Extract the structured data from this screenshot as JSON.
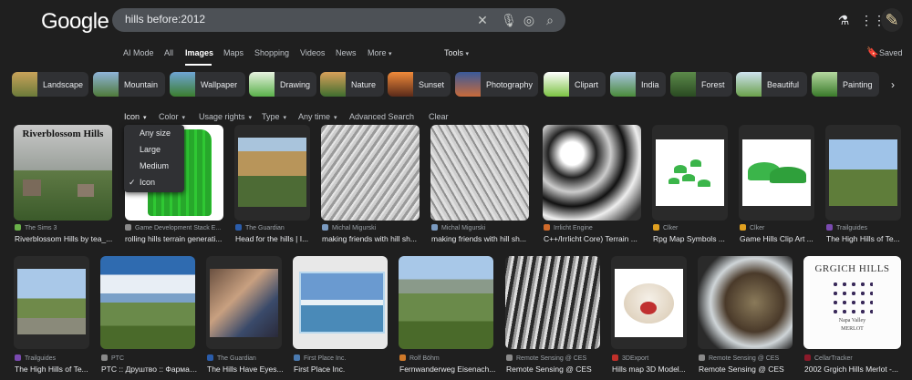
{
  "brand": {
    "logo": "Google"
  },
  "search": {
    "query": "hills before:2012"
  },
  "header": {
    "saved_label": "Saved"
  },
  "tabs": [
    {
      "label": "AI Mode"
    },
    {
      "label": "All"
    },
    {
      "label": "Images",
      "active": true
    },
    {
      "label": "Maps"
    },
    {
      "label": "Shopping"
    },
    {
      "label": "Videos"
    },
    {
      "label": "News"
    },
    {
      "label": "More"
    },
    {
      "label": "Tools"
    }
  ],
  "chips": [
    {
      "label": "Landscape"
    },
    {
      "label": "Mountain"
    },
    {
      "label": "Wallpaper"
    },
    {
      "label": "Drawing"
    },
    {
      "label": "Nature"
    },
    {
      "label": "Sunset"
    },
    {
      "label": "Photography"
    },
    {
      "label": "Clipart"
    },
    {
      "label": "India"
    },
    {
      "label": "Forest"
    },
    {
      "label": "Beautiful"
    },
    {
      "label": "Painting"
    }
  ],
  "filters": {
    "icon": "Icon",
    "color": "Color",
    "usage_rights": "Usage rights",
    "type": "Type",
    "time": "Any time",
    "advanced": "Advanced Search",
    "clear": "Clear"
  },
  "size_menu": {
    "items": [
      {
        "label": "Any size"
      },
      {
        "label": "Large"
      },
      {
        "label": "Medium"
      },
      {
        "label": "Icon",
        "checked": true
      }
    ]
  },
  "results_row1": [
    {
      "source": "The Sims 3",
      "title": "Riverblossom Hills by tea_..."
    },
    {
      "source": "Game Development Stack E...",
      "title": "rolling hills terrain generati..."
    },
    {
      "source": "The Guardian",
      "title": "Head for the hills | I..."
    },
    {
      "source": "Michal Migurski",
      "title": "making friends with hill sh..."
    },
    {
      "source": "Michal Migurski",
      "title": "making friends with hill sh..."
    },
    {
      "source": "Irrlicht Engine",
      "title": "C++/Irrlicht Core) Terrain ..."
    },
    {
      "source": "Clker",
      "title": "Rpg Map Symbols ..."
    },
    {
      "source": "Clker",
      "title": "Game Hills Clip Art ..."
    },
    {
      "source": "Trailguides",
      "title": "The High Hills of Te..."
    }
  ],
  "results_row2": [
    {
      "source": "Trailguides",
      "title": "The High Hills of Te..."
    },
    {
      "source": "PTC",
      "title": "PTC :: Друштво :: Фарма ..."
    },
    {
      "source": "The Guardian",
      "title": "The Hills Have Eyes..."
    },
    {
      "source": "First Place Inc.",
      "title": "First Place Inc."
    },
    {
      "source": "Rolf Böhm",
      "title": "Fernwanderweg Eisenach..."
    },
    {
      "source": "Remote Sensing @ CES",
      "title": "Remote Sensing @ CES"
    },
    {
      "source": "3DExport",
      "title": "Hills map 3D Model..."
    },
    {
      "source": "Remote Sensing @ CES",
      "title": "Remote Sensing @ CES"
    },
    {
      "source": "CellarTracker",
      "title": "2002 Grgich Hills Merlot -..."
    }
  ],
  "image_text": {
    "riverblossom": "Riverblossom Hills",
    "grgich": "GRGICH HILLS",
    "grgich_sub1": "Napa Valley",
    "grgich_sub2": "MERLOT"
  }
}
